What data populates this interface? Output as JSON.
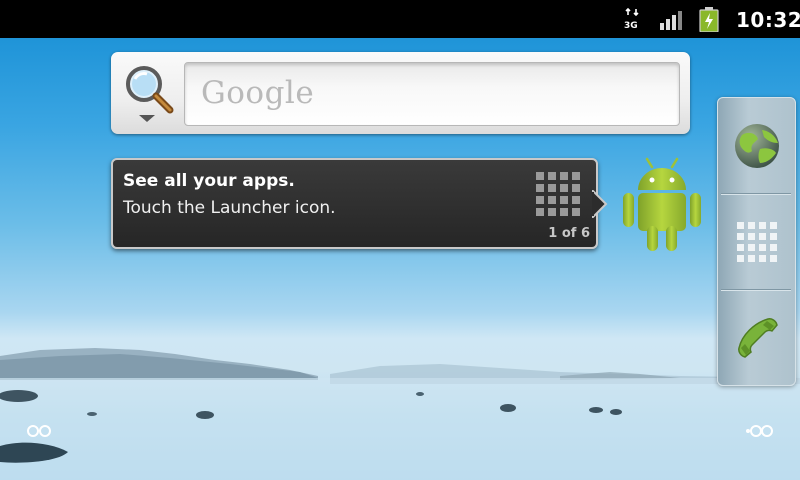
{
  "status_bar": {
    "network_type": "3G",
    "time": "10:32",
    "icons": [
      "network-3g-icon",
      "signal-strength-icon",
      "battery-charging-icon"
    ]
  },
  "search_widget": {
    "placeholder": "Google",
    "icon": "magnifier-icon"
  },
  "hint": {
    "title": "See all your apps.",
    "body": "Touch the Launcher icon.",
    "page_count": "1 of 6"
  },
  "dock": {
    "items": [
      "browser-globe-icon",
      "launcher-grid-icon",
      "phone-icon"
    ]
  },
  "colors": {
    "android_green": "#9fc236",
    "status_bar": "#000000",
    "hint_background": "#2e2e2e"
  }
}
